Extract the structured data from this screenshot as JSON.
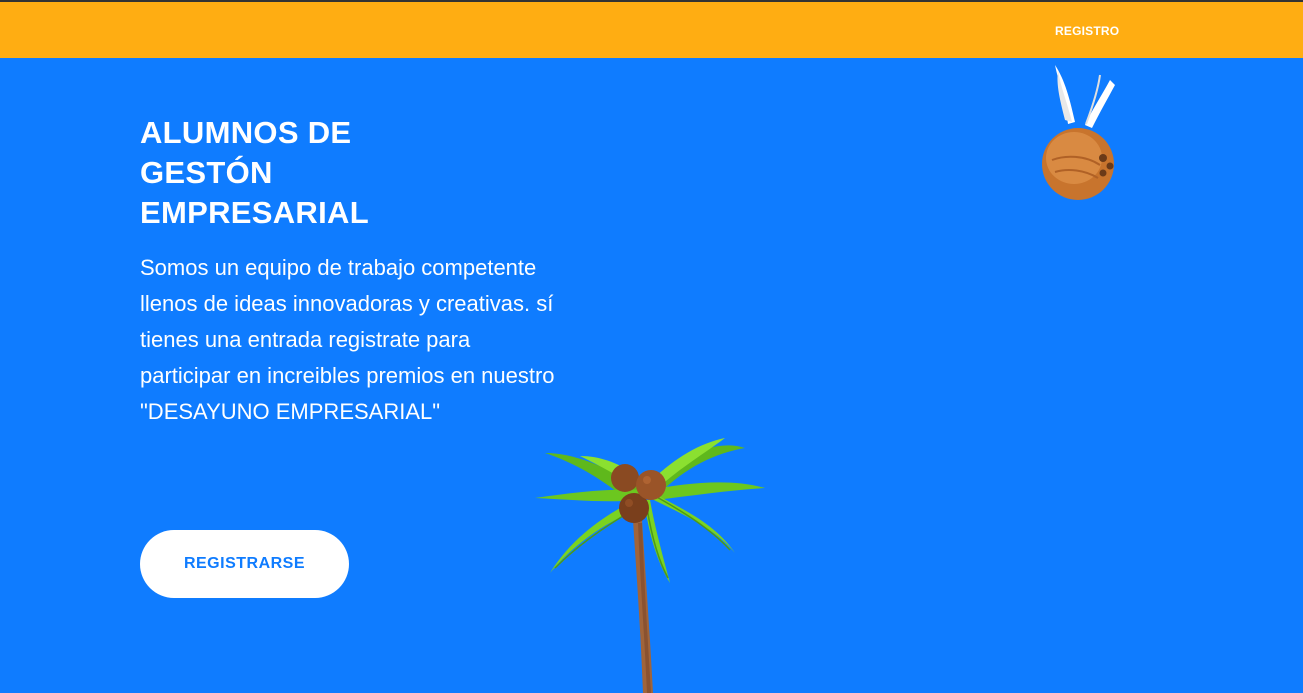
{
  "navbar": {
    "register_link": "REGISTRO"
  },
  "hero": {
    "title": "ALUMNOS DE GESTÓN EMPRESARIAL",
    "description": "Somos un equipo de trabajo competente llenos de ideas innovadoras y creativas. sí tienes una entrada registrate para participar en increibles premios en nuestro \"DESAYUNO EMPRESARIAL\"",
    "cta_label": "REGISTRARSE"
  },
  "illustrations": {
    "top_right": "coconut-with-wings",
    "bottom_center": "palm-tree"
  },
  "colors": {
    "navbar": "#ffad12",
    "background": "#0f7cff",
    "button_bg": "#ffffff",
    "button_text": "#0f7cff",
    "leaf": "#7ad321",
    "trunk": "#a0643a",
    "coconut": "#c8742d"
  }
}
